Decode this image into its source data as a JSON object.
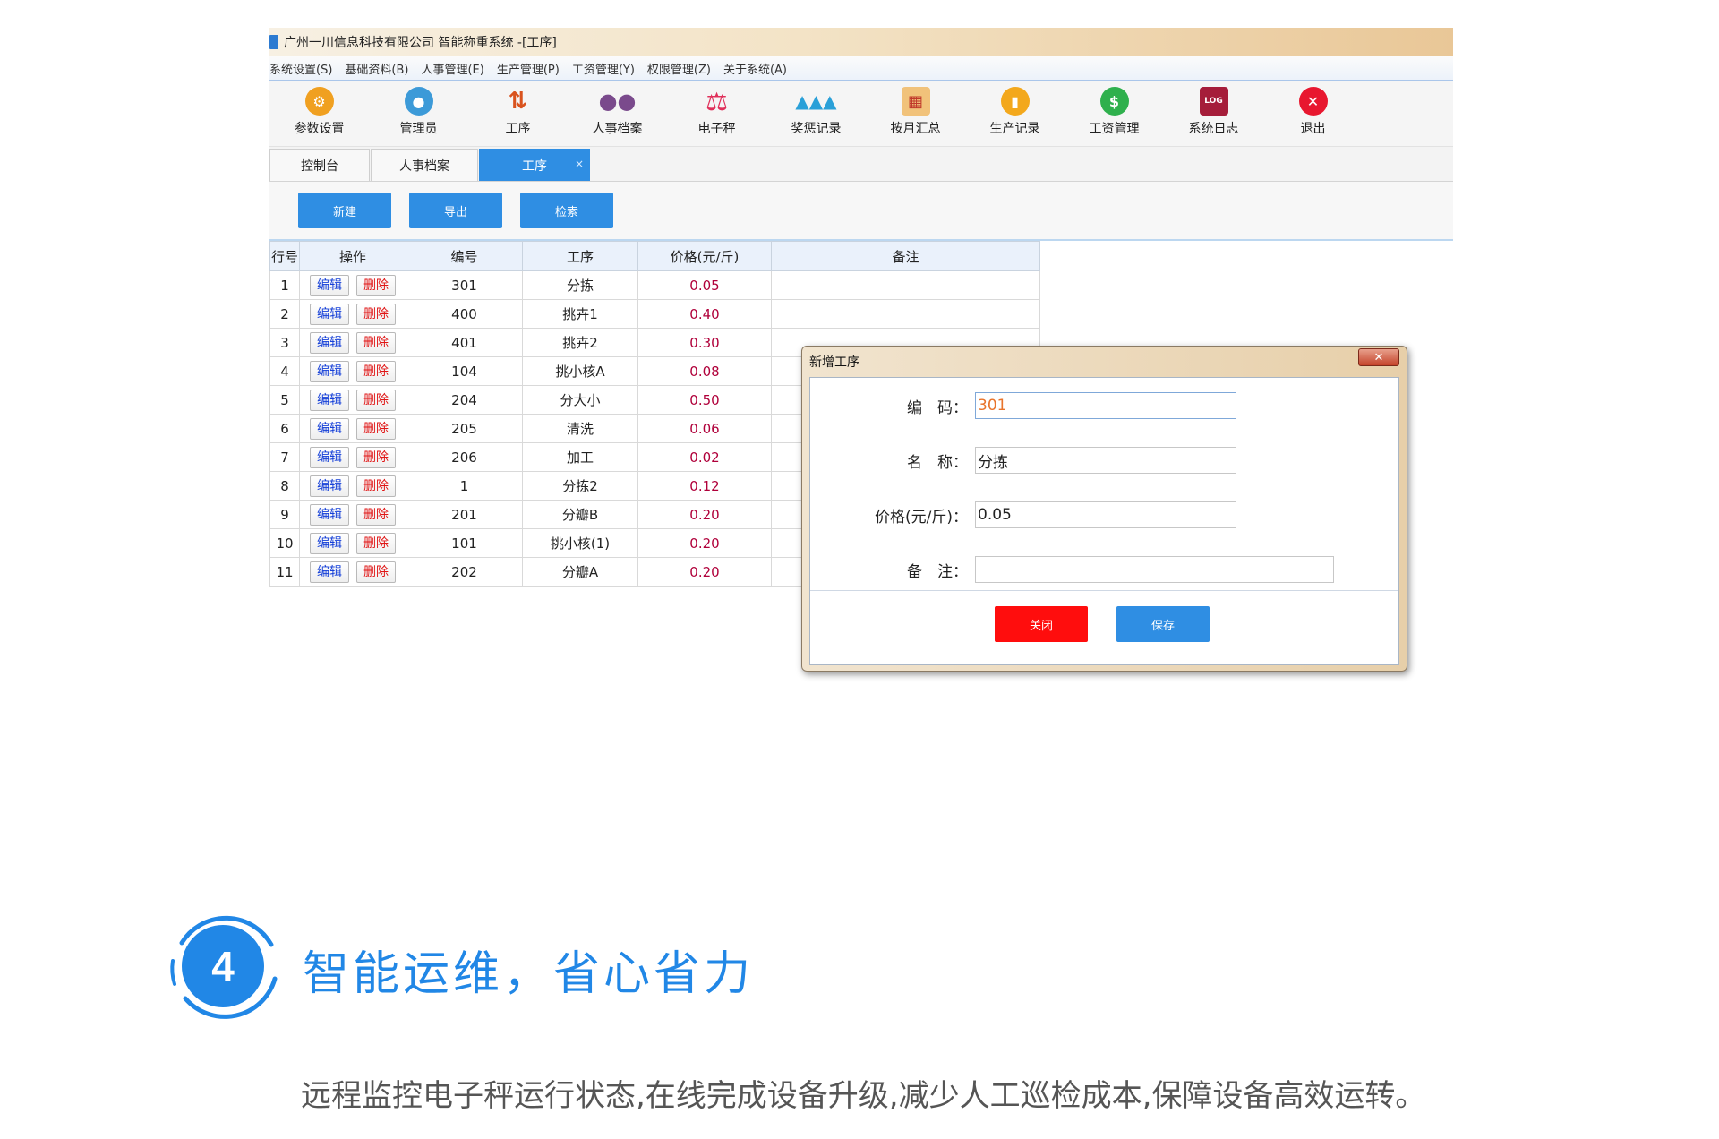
{
  "window": {
    "title": "广州一川信息科技有限公司 智能称重系统 -[工序]"
  },
  "menu": [
    "系统设置(S)",
    "基础资料(B)",
    "人事管理(E)",
    "生产管理(P)",
    "工资管理(Y)",
    "权限管理(Z)",
    "关于系统(A)"
  ],
  "toolbar": [
    {
      "label": "参数设置",
      "icon": "gear-icon",
      "glyph": "⚙",
      "color": "#f0a020"
    },
    {
      "label": "管理员",
      "icon": "user-icon",
      "glyph": "👤",
      "color": "#3c9ad8"
    },
    {
      "label": "工序",
      "icon": "arrows-icon",
      "glyph": "⇅",
      "color": "#ffffff"
    },
    {
      "label": "人事档案",
      "icon": "people-icon",
      "glyph": "👥",
      "color": "#ffffff"
    },
    {
      "label": "电子秤",
      "icon": "scale-icon",
      "glyph": "⚖",
      "color": "#ffffff"
    },
    {
      "label": "奖惩记录",
      "icon": "team-icon",
      "glyph": "👪",
      "color": "#ffffff"
    },
    {
      "label": "按月汇总",
      "icon": "calendar-icon",
      "glyph": "▦",
      "color": "#f1c27a"
    },
    {
      "label": "生产记录",
      "icon": "chart-icon",
      "glyph": "▮",
      "color": "#f3a81c"
    },
    {
      "label": "工资管理",
      "icon": "dollar-icon",
      "glyph": "$",
      "color": "#2fb04d"
    },
    {
      "label": "系统日志",
      "icon": "log-icon",
      "glyph": "LOG",
      "color": "#a51d3a"
    },
    {
      "label": "退出",
      "icon": "exit-icon",
      "glyph": "✕",
      "color": "#e8172f"
    }
  ],
  "tabs": {
    "console": "控制台",
    "personnel": "人事档案",
    "process": "工序",
    "close_glyph": "×"
  },
  "actions": {
    "new": "新建",
    "export": "导出",
    "search": "检索"
  },
  "table": {
    "headers": [
      "行号",
      "操作",
      "编号",
      "工序",
      "价格(元/斤)",
      "备注"
    ],
    "edit_label": "编辑",
    "delete_label": "删除",
    "rows": [
      {
        "n": "1",
        "code": "301",
        "process": "分拣",
        "price": "0.05",
        "note": ""
      },
      {
        "n": "2",
        "code": "400",
        "process": "挑卉1",
        "price": "0.40",
        "note": ""
      },
      {
        "n": "3",
        "code": "401",
        "process": "挑卉2",
        "price": "0.30",
        "note": ""
      },
      {
        "n": "4",
        "code": "104",
        "process": "挑小核A",
        "price": "0.08",
        "note": ""
      },
      {
        "n": "5",
        "code": "204",
        "process": "分大小",
        "price": "0.50",
        "note": ""
      },
      {
        "n": "6",
        "code": "205",
        "process": "清洗",
        "price": "0.06",
        "note": ""
      },
      {
        "n": "7",
        "code": "206",
        "process": "加工",
        "price": "0.02",
        "note": ""
      },
      {
        "n": "8",
        "code": "1",
        "process": "分拣2",
        "price": "0.12",
        "note": ""
      },
      {
        "n": "9",
        "code": "201",
        "process": "分瓣B",
        "price": "0.20",
        "note": ""
      },
      {
        "n": "10",
        "code": "101",
        "process": "挑小核(1)",
        "price": "0.20",
        "note": ""
      },
      {
        "n": "11",
        "code": "202",
        "process": "分瓣A",
        "price": "0.20",
        "note": ""
      }
    ]
  },
  "dialog": {
    "title": "新增工序",
    "close_glyph": "✕",
    "fields": {
      "code_label": "编　码：",
      "code_value": "301",
      "name_label": "名　称：",
      "name_value": "分拣",
      "price_label": "价格(元/斤)：",
      "price_value": "0.05",
      "note_label": "备　注：",
      "note_value": ""
    },
    "close_button": "关闭",
    "save_button": "保存"
  },
  "feature": {
    "number": "4",
    "title": "智能运维，省心省力",
    "description": "远程监控电子秤运行状态,在线完成设备升级,减少人工巡检成本,保障设备高效运转。",
    "accent": "#2187e6"
  }
}
